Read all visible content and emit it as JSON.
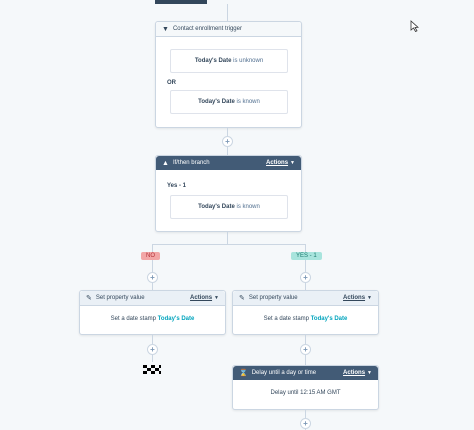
{
  "trigger": {
    "title": "Contact enrollment trigger",
    "filter1": {
      "field": "Today's Date",
      "condition": "is unknown"
    },
    "or_label": "OR",
    "filter2": {
      "field": "Today's Date",
      "condition": "is known"
    }
  },
  "branch": {
    "title": "If/then branch",
    "actions_label": "Actions",
    "yes_label": "Yes - 1",
    "filter": {
      "field": "Today's Date",
      "condition": "is known"
    }
  },
  "badges": {
    "no": "NO",
    "yes": "YES - 1"
  },
  "action_left": {
    "title": "Set property value",
    "actions_label": "Actions",
    "body_prefix": "Set a date stamp",
    "body_value": "Today's Date"
  },
  "action_right": {
    "title": "Set property value",
    "actions_label": "Actions",
    "body_prefix": "Set a date stamp",
    "body_value": "Today's Date"
  },
  "delay": {
    "title": "Delay until a day or time",
    "actions_label": "Actions",
    "body": "Delay until 12:15 AM GMT"
  },
  "plus_symbol": "+",
  "icons": {
    "trigger": "user-download-icon",
    "branch": "warning-triangle-icon",
    "set_property": "edit-box-icon",
    "delay": "hourglass-icon",
    "end": "checkered-flag-icon",
    "cursor": "mouse-pointer-icon"
  }
}
